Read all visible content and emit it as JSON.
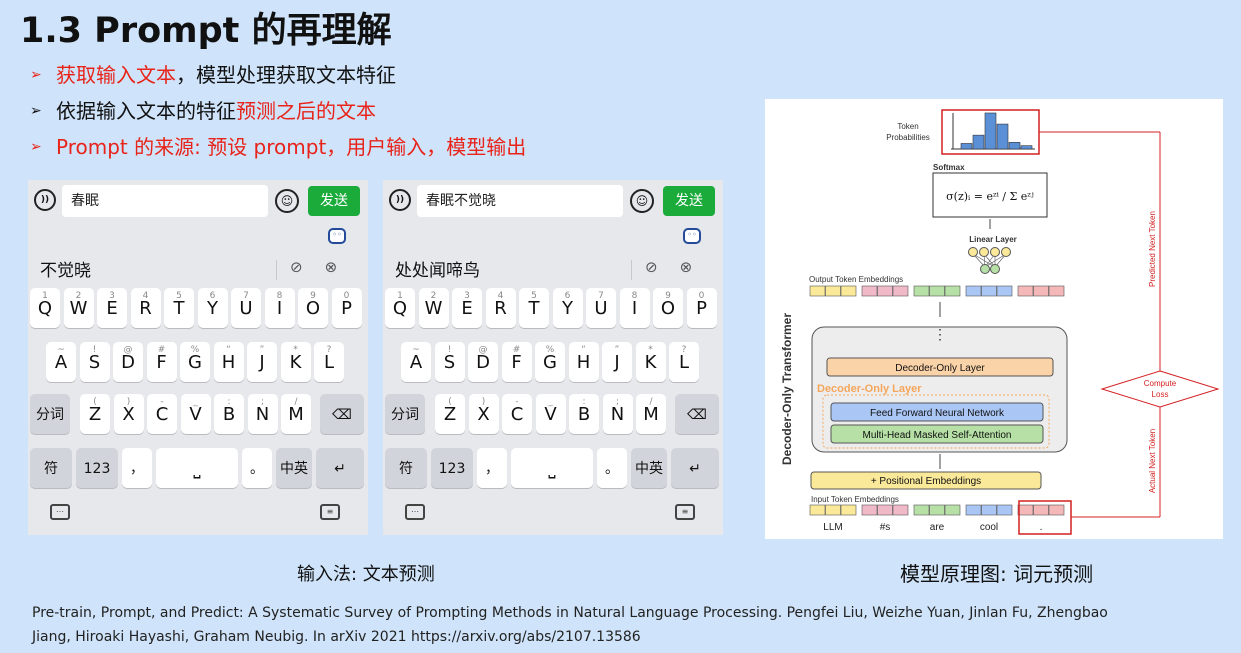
{
  "slide": {
    "title": "1.3 Prompt 的再理解",
    "bullet_marker": "➢",
    "bullets": [
      {
        "red": "获取输入文本",
        "black": "，模型处理获取文本特征"
      },
      {
        "black": "依据输入文本的特征",
        "red": "预测之后的文本"
      },
      {
        "red": "Prompt 的来源: 预设 prompt，用户输入，模型输出"
      }
    ]
  },
  "keyboard_left": {
    "input_text": "春眠",
    "send_label": "发送",
    "candidate": "不觉晓"
  },
  "keyboard_right": {
    "input_text": "春眠不觉晓",
    "send_label": "发送",
    "candidate": "处处闻啼鸟"
  },
  "keyboard_keys": {
    "row1": [
      "Q",
      "W",
      "E",
      "R",
      "T",
      "Y",
      "U",
      "I",
      "O",
      "P"
    ],
    "row1_sub": [
      "1",
      "2",
      "3",
      "4",
      "5",
      "6",
      "7",
      "8",
      "9",
      "0"
    ],
    "row2": [
      "A",
      "S",
      "D",
      "F",
      "G",
      "H",
      "J",
      "K",
      "L"
    ],
    "row2_sub": [
      "~",
      "!",
      "@",
      "#",
      "%",
      "“",
      "”",
      "*",
      "?"
    ],
    "row3": [
      "Z",
      "X",
      "C",
      "V",
      "B",
      "N",
      "M"
    ],
    "row3_sub": [
      "(",
      ")",
      "-",
      "_",
      ":",
      ";",
      "/"
    ],
    "fenci": "分词",
    "fu": "符",
    "num": "123",
    "comma": "，",
    "period": "。",
    "zhong": "中",
    "zhong_sub": "英"
  },
  "diagram": {
    "token_probabilities": "Token\nProbabilities",
    "softmax": "Softmax",
    "linear_layer": "Linear Layer",
    "output_embeddings": "Output Token Embeddings",
    "decoder_layer": "Decoder-Only Layer",
    "decoder_layer_orange": "Decoder-Only Layer",
    "ffn": "Feed Forward Neural Network",
    "attention": "Multi-Head Masked Self-Attention",
    "positional": "+ Positional Embeddings",
    "input_embeddings": "Input Token Embeddings",
    "side_label": "Decoder-Only Transformer",
    "input_tokens": [
      "LLM",
      "#s",
      "are",
      "cool",
      "."
    ],
    "predicted_next_token": "Predicted Next Token",
    "actual_next_token": "Actual Next Token",
    "compute_loss": "Compute Loss",
    "token_prob_values": [
      0.1,
      0.25,
      0.65,
      0.45,
      0.12,
      0.06
    ]
  },
  "captions": {
    "left": "输入法: 文本预测",
    "right": "模型原理图: 词元预测"
  },
  "reference": "Pre-train, Prompt, and Predict: A Systematic Survey of Prompting Methods in Natural Language Processing. Pengfei Liu, Weizhe Yuan, Jinlan Fu, Zhengbao Jiang, Hiroaki Hayashi, Graham Neubig. In arXiv 2021 https://arxiv.org/abs/2107.13586"
}
